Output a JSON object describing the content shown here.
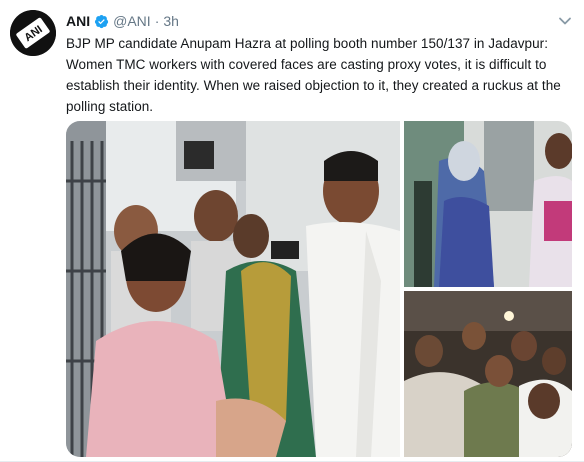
{
  "tweet": {
    "author_name": "ANI",
    "author_handle": "@ANI",
    "separator": "·",
    "time": "3h",
    "text": "BJP MP candidate Anupam Hazra  at polling booth number 150/137 in Jadavpur: Women TMC workers with covered faces are casting proxy votes, it is difficult to establish their identity. When we raised objection to it, they created a ruckus at the polling station.",
    "avatar_logo_text": "ANI"
  },
  "icons": {
    "verified": "verified-badge-icon",
    "caret": "chevron-down-icon"
  },
  "colors": {
    "verified": "#1da1f2",
    "text": "#14171a",
    "muted": "#657786"
  }
}
